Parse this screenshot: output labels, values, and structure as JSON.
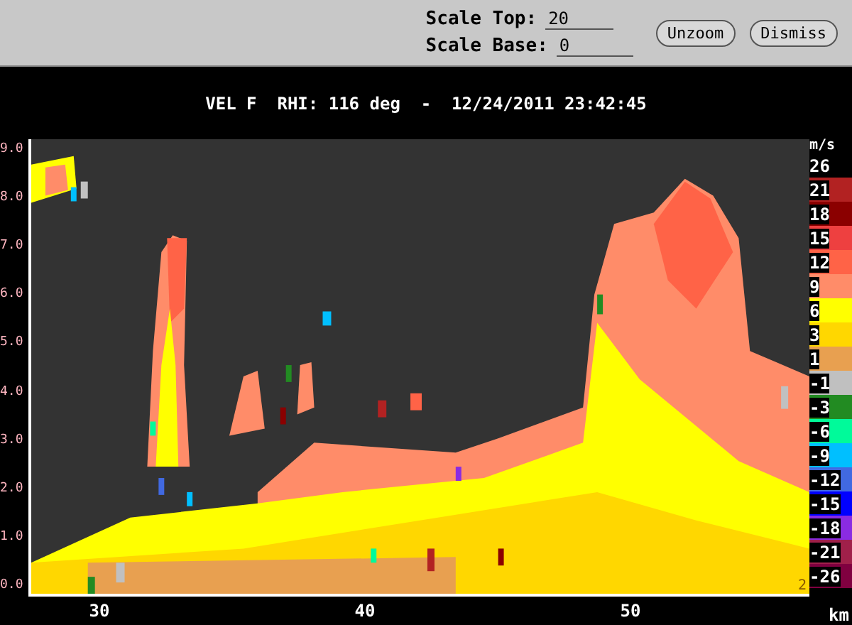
{
  "toolbar": {
    "fields": [
      {
        "label": "Scale Top:",
        "value": "20"
      },
      {
        "label": "Scale Base:",
        "value": "0"
      }
    ],
    "buttons": [
      "Unzoom",
      "Dismiss"
    ]
  },
  "plot": {
    "title": "VEL F  RHI: 116 deg  -  12/24/2011 23:42:45",
    "y_ticks": [
      "9.0",
      "8.0",
      "7.0",
      "6.0",
      "5.0",
      "4.0",
      "3.0",
      "2.0",
      "1.0",
      "0.0"
    ],
    "x_ticks": [
      "30",
      "40",
      "50"
    ],
    "x_unit": "km",
    "corner_mark": "2"
  },
  "legend": {
    "unit": "m/s",
    "entries": [
      {
        "label": "26",
        "color": "#000000"
      },
      {
        "label": "21",
        "color": "#b22222"
      },
      {
        "label": "18",
        "color": "#8b0000"
      },
      {
        "label": "15",
        "color": "#ee4040"
      },
      {
        "label": "12",
        "color": "#ff6347"
      },
      {
        "label": "9",
        "color": "#ff8c69"
      },
      {
        "label": "6",
        "color": "#ffff00"
      },
      {
        "label": "3",
        "color": "#ffd700"
      },
      {
        "label": "1",
        "color": "#e8a050"
      },
      {
        "label": "-1",
        "color": "#c0c0c0"
      },
      {
        "label": "-3",
        "color": "#228b22"
      },
      {
        "label": "-6",
        "color": "#00fa9a"
      },
      {
        "label": "-9",
        "color": "#00bfff"
      },
      {
        "label": "-12",
        "color": "#4169e1"
      },
      {
        "label": "-15",
        "color": "#0000ff"
      },
      {
        "label": "-18",
        "color": "#8a2be2"
      },
      {
        "label": "-21",
        "color": "#a0204a"
      },
      {
        "label": "-26",
        "color": "#800040"
      }
    ]
  }
}
